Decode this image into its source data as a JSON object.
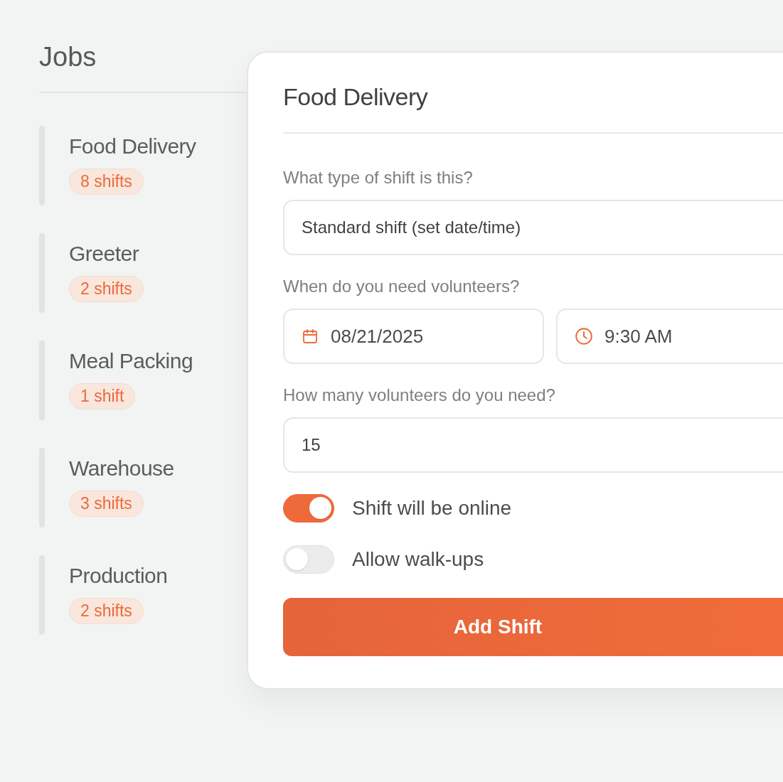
{
  "sidebar": {
    "title": "Jobs",
    "items": [
      {
        "name": "Food Delivery",
        "badge": "8 shifts"
      },
      {
        "name": "Greeter",
        "badge": "2 shifts"
      },
      {
        "name": "Meal Packing",
        "badge": "1 shift"
      },
      {
        "name": "Warehouse",
        "badge": "3 shifts"
      },
      {
        "name": "Production",
        "badge": "2 shifts"
      }
    ]
  },
  "form": {
    "title": "Food Delivery",
    "shift_type": {
      "label": "What type of shift is this?",
      "value": "Standard shift (set date/time)"
    },
    "when": {
      "label": "When do you need volunteers?",
      "date": "08/21/2025",
      "time": "9:30 AM"
    },
    "count": {
      "label": "How many volunteers do you need?",
      "value": "15"
    },
    "toggles": [
      {
        "label": "Shift will be online",
        "on": true
      },
      {
        "label": "Allow walk-ups",
        "on": false
      }
    ],
    "submit": "Add Shift"
  }
}
